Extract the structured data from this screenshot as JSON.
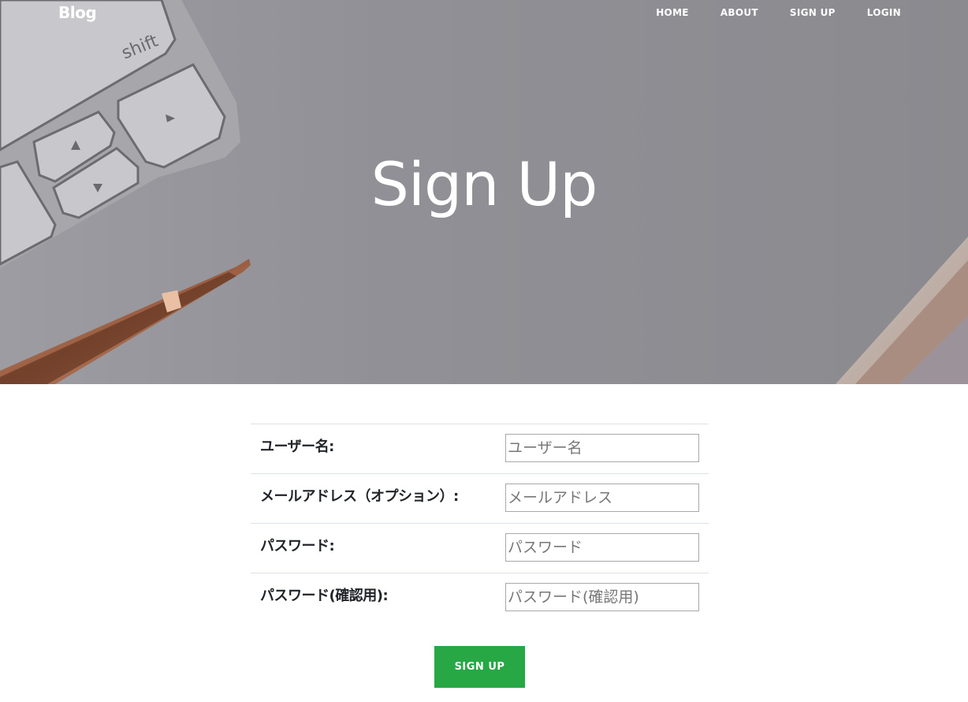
{
  "navbar": {
    "brand": "Blog",
    "links": [
      {
        "label": "HOME"
      },
      {
        "label": "ABOUT"
      },
      {
        "label": "SIGN UP"
      },
      {
        "label": "LOGIN"
      }
    ]
  },
  "hero": {
    "title": "Sign Up",
    "keyboard_key_label": "shift"
  },
  "form": {
    "fields": [
      {
        "label": "ユーザー名:",
        "placeholder": "ユーザー名",
        "value": ""
      },
      {
        "label": "メールアドレス（オプション）:",
        "placeholder": "メールアドレス",
        "value": ""
      },
      {
        "label": "パスワード:",
        "placeholder": "パスワード",
        "value": ""
      },
      {
        "label": "パスワード(確認用):",
        "placeholder": "パスワード(確認用)",
        "value": ""
      }
    ],
    "submit_label": "SIGN UP"
  },
  "colors": {
    "submit_button": "#28a745",
    "hero_overlay": "#8e8e93",
    "text": "#212529"
  }
}
